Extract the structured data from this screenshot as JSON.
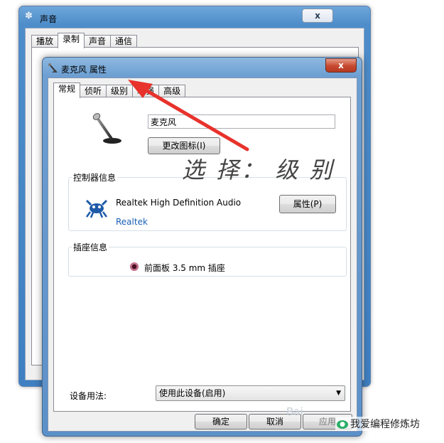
{
  "sound_window": {
    "title": "声音",
    "close_label": "x",
    "tabs": [
      {
        "label": "播放"
      },
      {
        "label": "录制"
      },
      {
        "label": "声音"
      },
      {
        "label": "通信"
      }
    ]
  },
  "mic_window": {
    "title": "麦克风 属性",
    "close_label": "x",
    "tabs": [
      {
        "label": "常规"
      },
      {
        "label": "侦听"
      },
      {
        "label": "级别"
      },
      {
        "label": "增强"
      },
      {
        "label": "高级"
      }
    ],
    "device_name": "麦克风",
    "change_icon_label": "更改图标(I)",
    "controller_group": {
      "title": "控制器信息",
      "name": "Realtek High Definition Audio",
      "vendor": "Realtek",
      "properties_label": "属性(P)"
    },
    "jack_group": {
      "title": "插座信息",
      "jack_text": "前面板 3.5 mm 插座",
      "jack_color": "#c0607f"
    },
    "usage_label": "设备用法:",
    "usage_value": "使用此设备(启用)",
    "ok_label": "确定",
    "cancel_label": "取消",
    "apply_label": "应用"
  },
  "annotation": {
    "text": "选 择： 级 别",
    "arrow_color": "#e8322c"
  },
  "watermark": {
    "logo_text": "Bai",
    "text": "我爱编程修炼坊"
  }
}
